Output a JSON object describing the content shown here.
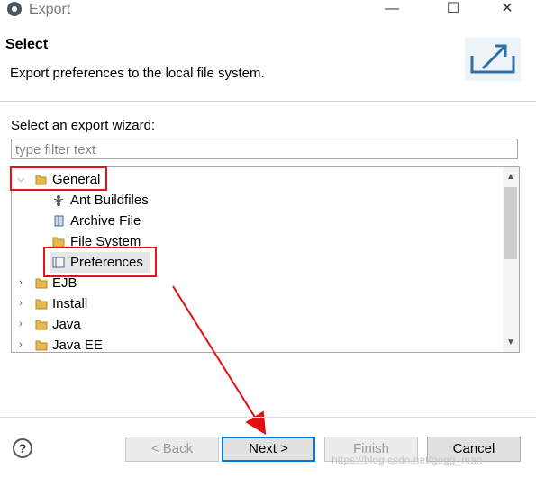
{
  "window": {
    "title": "Export",
    "minimize_glyph": "—",
    "maximize_glyph": "☐",
    "close_glyph": "✕"
  },
  "header": {
    "title": "Select",
    "description": "Export preferences to the local file system."
  },
  "wizard": {
    "label": "Select an export wizard:",
    "filter_placeholder": "type filter text",
    "tree": [
      {
        "label": "General",
        "expanded": true,
        "icon": "folder-open-icon"
      },
      {
        "label": "Ant Buildfiles",
        "icon": "ant-icon"
      },
      {
        "label": "Archive File",
        "icon": "archive-icon"
      },
      {
        "label": "File System",
        "icon": "folder-icon"
      },
      {
        "label": "Preferences",
        "icon": "preferences-icon",
        "selected": true
      },
      {
        "label": "EJB",
        "icon": "folder-icon"
      },
      {
        "label": "Install",
        "icon": "folder-icon"
      },
      {
        "label": "Java",
        "icon": "folder-icon"
      },
      {
        "label": "Java EE",
        "icon": "folder-icon"
      }
    ]
  },
  "footer": {
    "help_glyph": "?",
    "back_label": "< Back",
    "next_label": "Next >",
    "finish_label": "Finish",
    "cancel_label": "Cancel"
  },
  "watermark": "https://blog.csdn.net/gogg_man",
  "colors": {
    "annotation": "#e11111",
    "selection": "#e6e6e6",
    "default_button_border": "#0078d7"
  }
}
